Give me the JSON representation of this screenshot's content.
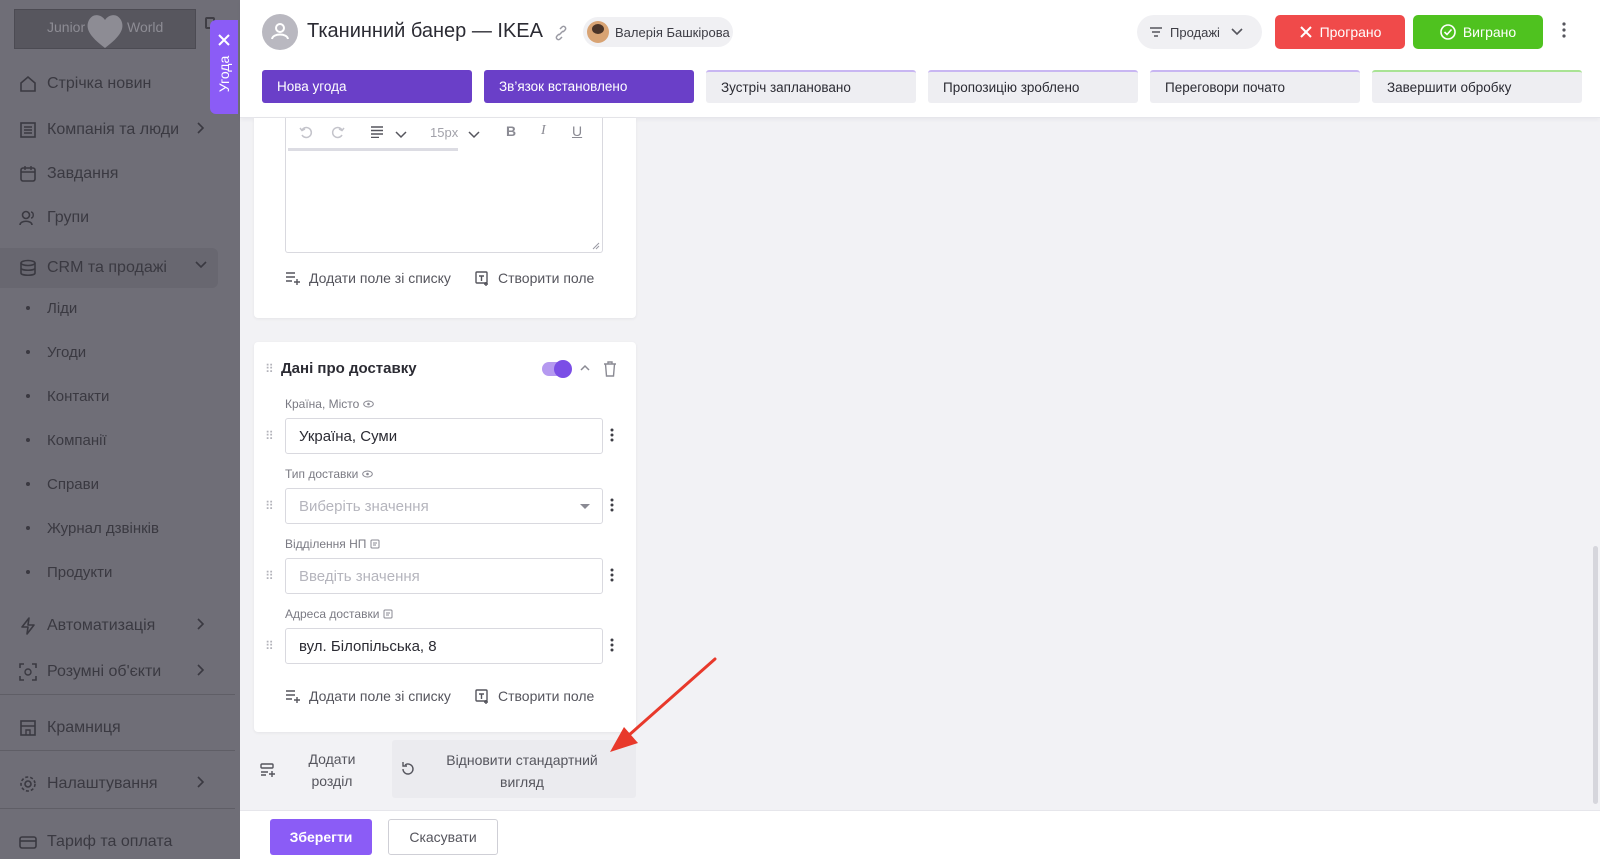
{
  "sidebar": {
    "logo_left": "Junior",
    "logo_right": "World",
    "items": [
      {
        "label": "Стрічка новин",
        "icon": "home-icon"
      },
      {
        "label": "Компанія та люди",
        "icon": "building-icon"
      },
      {
        "label": "Завдання",
        "icon": "calendar-icon"
      },
      {
        "label": "Групи",
        "icon": "users-icon"
      },
      {
        "label": "CRM та продажі",
        "icon": "database-icon"
      },
      {
        "label": "Автоматизація",
        "icon": "lightning-icon"
      },
      {
        "label": "Розумні об'єкти",
        "icon": "smart-object-icon"
      },
      {
        "label": "Крамниця",
        "icon": "store-icon"
      },
      {
        "label": "Налаштування",
        "icon": "gear-icon"
      },
      {
        "label": "Тариф та оплата",
        "icon": "card-icon"
      }
    ],
    "crm_sub": [
      "Ліди",
      "Угоди",
      "Контакти",
      "Компанії",
      "Справи",
      "Журнал дзвінків",
      "Продукти"
    ]
  },
  "deal_tab": {
    "label": "Угода"
  },
  "header": {
    "title": "Тканинний банер — IKEA",
    "responsible": "Валерія Башкірова",
    "pipeline": "Продажі",
    "lost_label": "Програно",
    "won_label": "Виграно"
  },
  "stages": [
    {
      "label": "Нова угода",
      "state": "active"
    },
    {
      "label": "Зв’язок встановлено",
      "state": "active"
    },
    {
      "label": "Зустріч заплановано",
      "state": "idle"
    },
    {
      "label": "Пропозицію зроблено",
      "state": "idle"
    },
    {
      "label": "Переговори почато",
      "state": "idle"
    },
    {
      "label": "Завершити обробку",
      "state": "final"
    }
  ],
  "editor": {
    "font_size": "15px"
  },
  "add_field_from_list": "Додати поле зі списку",
  "create_field": "Створити поле",
  "delivery_section": {
    "title": "Дані про доставку",
    "enabled": true,
    "fields": [
      {
        "label": "Країна, Місто",
        "value": "Україна, Суми",
        "placeholder": ""
      },
      {
        "label": "Тип доставки",
        "value": "",
        "placeholder": "Виберіть значення"
      },
      {
        "label": "Відділення НП",
        "value": "",
        "placeholder": "Введіть значення"
      },
      {
        "label": "Адреса доставки",
        "value": "вул. Білопільська, 8",
        "placeholder": ""
      }
    ]
  },
  "actions": {
    "add_section_line1": "Додати",
    "add_section_line2": "розділ",
    "restore_line1": "Відновити стандартний",
    "restore_line2": "вигляд"
  },
  "footer": {
    "save": "Зберегти",
    "cancel": "Скасувати"
  },
  "colors": {
    "accent": "#8b5cf6",
    "stage_active": "#6a3fc8",
    "lost": "#f04a4a",
    "won": "#4fc21f",
    "annotation_arrow": "#e8392b"
  }
}
